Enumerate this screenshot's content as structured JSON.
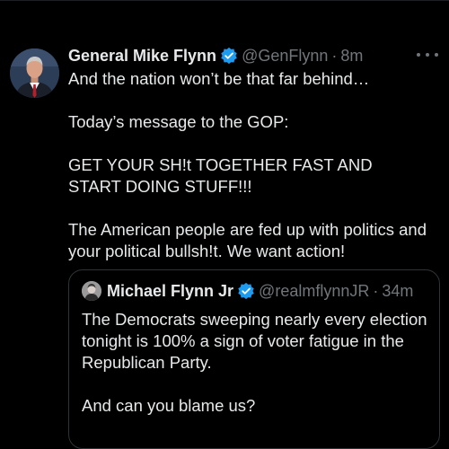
{
  "tweet": {
    "author_name": "General Mike Flynn",
    "author_handle": "@GenFlynn",
    "time": "8m",
    "dot": "·",
    "verified_icon": "verified-check-icon",
    "more_icon": "ellipsis-icon",
    "paragraphs": [
      "And the nation won’t be that far behind…",
      "Today’s message to the GOP:",
      "GET YOUR SH!t TOGETHER FAST AND START DOING STUFF!!!",
      "The American people are fed up with politics and your political bullsh!t. We want action!"
    ]
  },
  "quoted_tweet": {
    "author_name": "Michael Flynn Jr",
    "author_handle": "@realmflynnJR",
    "dot": "·",
    "time": "34m",
    "paragraphs": [
      "The Democrats sweeping nearly every election tonight is 100% a sign of voter fatigue in the Republican Party.",
      "And can you blame us?"
    ]
  },
  "colors": {
    "background": "#000000",
    "text": "#e7e9ea",
    "secondary_text": "#71767b",
    "verified_blue": "#1d9bf0",
    "border": "#2f3336"
  }
}
